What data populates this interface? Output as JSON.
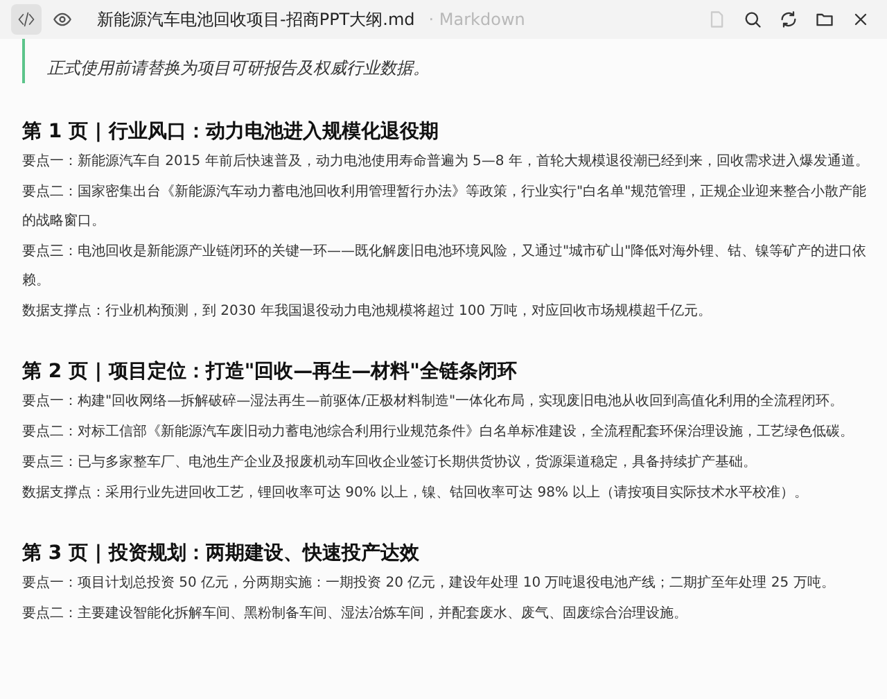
{
  "header": {
    "view_modes": [
      {
        "kind": "code",
        "selected": true
      },
      {
        "kind": "preview",
        "selected": false
      }
    ],
    "title": "新能源汽车电池回收项目-招商PPT大纲.md",
    "subtitle": "· Markdown"
  },
  "note": [
    "正式使用前请替换为项目可研报告及权威行业数据。"
  ],
  "sections": [
    {
      "heading": "第 1 页 | 行业风口：动力电池进入规模化退役期",
      "points": [
        "要点一：新能源汽车自 2015 年前后快速普及，动力电池使用寿命普遍为 5—8 年，首轮大规模退役潮已经到来，回收需求进入爆发通道。",
        "要点二：国家密集出台《新能源汽车动力蓄电池回收利用管理暂行办法》等政策，行业实行\"白名单\"规范管理，正规企业迎来整合小散产能的战略窗口。",
        "要点三：电池回收是新能源产业链闭环的关键一环——既化解废旧电池环境风险，又通过\"城市矿山\"降低对海外锂、钴、镍等矿产的进口依赖。",
        "数据支撑点：行业机构预测，到 2030 年我国退役动力电池规模将超过 100 万吨，对应回收市场规模超千亿元。"
      ]
    },
    {
      "heading": "第 2 页 | 项目定位：打造\"回收—再生—材料\"全链条闭环",
      "points": [
        "要点一：构建\"回收网络—拆解破碎—湿法再生—前驱体/正极材料制造\"一体化布局，实现废旧电池从收回到高值化利用的全流程闭环。",
        "要点二：对标工信部《新能源汽车废旧动力蓄电池综合利用行业规范条件》白名单标准建设，全流程配套环保治理设施，工艺绿色低碳。",
        "要点三：已与多家整车厂、电池生产企业及报废机动车回收企业签订长期供货协议，货源渠道稳定，具备持续扩产基础。",
        "数据支撑点：采用行业先进回收工艺，锂回收率可达 90% 以上，镍、钴回收率可达 98% 以上（请按项目实际技术水平校准）。"
      ]
    },
    {
      "heading": "第 3 页 | 投资规划：两期建设、快速投产达效",
      "points": [
        "要点一：项目计划总投资 50 亿元，分两期实施：一期投资 20 亿元，建设年处理 10 万吨退役电池产线；二期扩至年处理 25 万吨。",
        "要点二：主要建设智能化拆解车间、黑粉制备车间、湿法冶炼车间，并配套废水、废气、固废综合治理设施。"
      ]
    }
  ]
}
